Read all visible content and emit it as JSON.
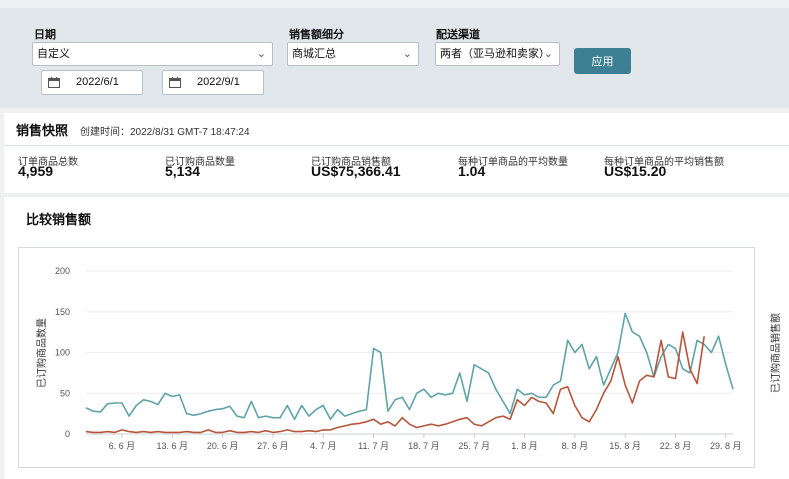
{
  "filters": {
    "date_label": "日期",
    "date_range_value": "自定义",
    "start_date": "2022/6/1",
    "end_date": "2022/9/1",
    "sales_breakdown_label": "销售额细分",
    "sales_breakdown_value": "商城汇总",
    "fulfillment_label": "配送渠道",
    "fulfillment_value": "两者（亚马逊和卖家）",
    "apply_label": "应用"
  },
  "snapshot": {
    "title": "销售快照",
    "created": "创建时间：2022/8/31 GMT-7 18:47:24",
    "metrics": [
      {
        "label": "订单商品总数",
        "value": "4,959"
      },
      {
        "label": "已订购商品数量",
        "value": "5,134"
      },
      {
        "label": "已订购商品销售额",
        "value": "US$75,366.41"
      },
      {
        "label": "每种订单商品的平均数量",
        "value": "1.04"
      },
      {
        "label": "每种订单商品的平均销售额",
        "value": "US$15.20"
      }
    ]
  },
  "chart_section": {
    "title": "比较销售额"
  },
  "colors": {
    "accent": "#3d7f93",
    "series_units": "#5fa3a8",
    "series_sales": "#b5563a"
  },
  "chart_data": {
    "type": "line",
    "ylabel": "已订购商品数量",
    "y2label": "已订购商品销售额",
    "ylim": [
      0,
      200
    ],
    "yticks": [
      "200",
      "150",
      "100",
      "50",
      "0"
    ],
    "yticks_values": [
      200,
      150,
      100,
      50,
      0
    ],
    "xticks": [
      "6. 6 月",
      "13. 6 月",
      "20. 6 月",
      "27. 6 月",
      "4. 7 月",
      "11. 7 月",
      "18. 7 月",
      "25. 7 月",
      "1. 8 月",
      "8. 8 月",
      "15. 8 月",
      "22. 8 月",
      "29. 8 月"
    ],
    "xticks_index": [
      5,
      12,
      19,
      26,
      33,
      40,
      47,
      54,
      61,
      68,
      75,
      82,
      89
    ],
    "grid": true,
    "series": [
      {
        "color": "#5fa3a8",
        "values": [
          32,
          28,
          27,
          37,
          38,
          38,
          22,
          35,
          42,
          40,
          36,
          50,
          46,
          48,
          25,
          23,
          25,
          28,
          30,
          31,
          34,
          22,
          20,
          40,
          20,
          22,
          20,
          20,
          35,
          18,
          35,
          22,
          30,
          35,
          18,
          30,
          22,
          25,
          28,
          30,
          105,
          100,
          28,
          42,
          45,
          30,
          50,
          55,
          45,
          50,
          48,
          50,
          75,
          40,
          85,
          80,
          75,
          55,
          40,
          25,
          55,
          48,
          50,
          45,
          45,
          60,
          65,
          115,
          100,
          110,
          80,
          95,
          60,
          80,
          100,
          148,
          125,
          120,
          100,
          70,
          95,
          110,
          105,
          80,
          75,
          115,
          110,
          100,
          120,
          85,
          55
        ]
      },
      {
        "color": "#b5563a",
        "values": [
          3,
          2,
          2,
          3,
          2,
          5,
          3,
          2,
          3,
          2,
          3,
          2,
          2,
          2,
          3,
          2,
          2,
          5,
          2,
          2,
          4,
          2,
          2,
          3,
          2,
          4,
          2,
          3,
          5,
          3,
          3,
          4,
          3,
          5,
          5,
          8,
          10,
          12,
          13,
          15,
          18,
          12,
          15,
          10,
          20,
          12,
          8,
          10,
          12,
          10,
          12,
          15,
          18,
          20,
          12,
          10,
          15,
          20,
          22,
          18,
          42,
          35,
          45,
          40,
          38,
          25,
          55,
          58,
          35,
          20,
          15,
          30,
          50,
          65,
          95,
          60,
          38,
          65,
          72,
          70,
          115,
          70,
          68,
          125,
          80,
          62,
          120
        ]
      }
    ]
  }
}
